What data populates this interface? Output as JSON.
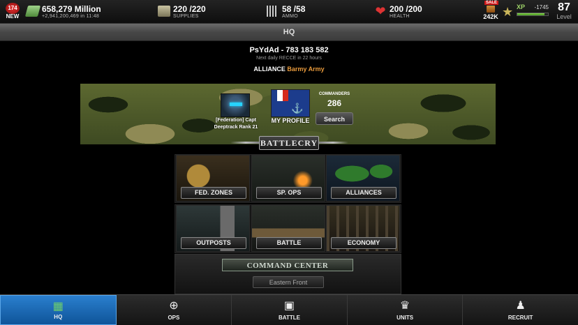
{
  "topbar": {
    "news": {
      "count": "174",
      "label": "NEW"
    },
    "cash": {
      "value": "658,279 Million",
      "sub": "+2,941,200,469 in 11:48",
      "icon": "cash-icon"
    },
    "supplies": {
      "value": "220 /220",
      "sub": "SUPPLIES",
      "icon": "supplies-icon"
    },
    "ammo": {
      "value": "58 /58",
      "sub": "AMMO",
      "icon": "ammo-icon"
    },
    "health": {
      "value": "200 /200",
      "sub": "HEALTH",
      "icon": "health-heart-icon"
    },
    "sale": {
      "tag": "SALE",
      "value": "242K"
    },
    "xp": {
      "label": "XP",
      "value": "-1745",
      "progress": 0.88
    },
    "level": {
      "value": "87",
      "label": "Level"
    }
  },
  "header": {
    "title": "HQ"
  },
  "player": {
    "name": "PsYdAd - 783 183 582",
    "recce": "Next daily RECCE in 22 hours",
    "alliance_label": "ALLIANCE",
    "alliance_name": "Barmy Army"
  },
  "profile": {
    "avatar_caption": "[Federation] Capt Deeptrack Rank 21",
    "my_profile": "MY PROFILE",
    "commanders_label": "COMMANDERS",
    "commanders_count": "286",
    "search_label": "Search"
  },
  "battlecry": {
    "label": "BATTLECRY"
  },
  "menu": [
    {
      "label": "FED. ZONES"
    },
    {
      "label": "SP. OPS"
    },
    {
      "label": "ALLIANCES"
    },
    {
      "label": "OUTPOSTS"
    },
    {
      "label": "BATTLE"
    },
    {
      "label": "ECONOMY"
    }
  ],
  "command_center": {
    "title": "COMMAND CENTER",
    "subtitle": "Eastern Front"
  },
  "nav": [
    {
      "label": "HQ",
      "icon": "hq-icon",
      "active": true
    },
    {
      "label": "OPS",
      "icon": "crosshair-icon"
    },
    {
      "label": "BATTLE",
      "icon": "tank-icon"
    },
    {
      "label": "UNITS",
      "icon": "soldier-icon"
    },
    {
      "label": "RECRUIT",
      "icon": "recruit-icon"
    }
  ],
  "colors": {
    "accent_orange": "#e89a3c",
    "nav_active": "#1a6fbf",
    "xp_green": "#8fdc56"
  }
}
